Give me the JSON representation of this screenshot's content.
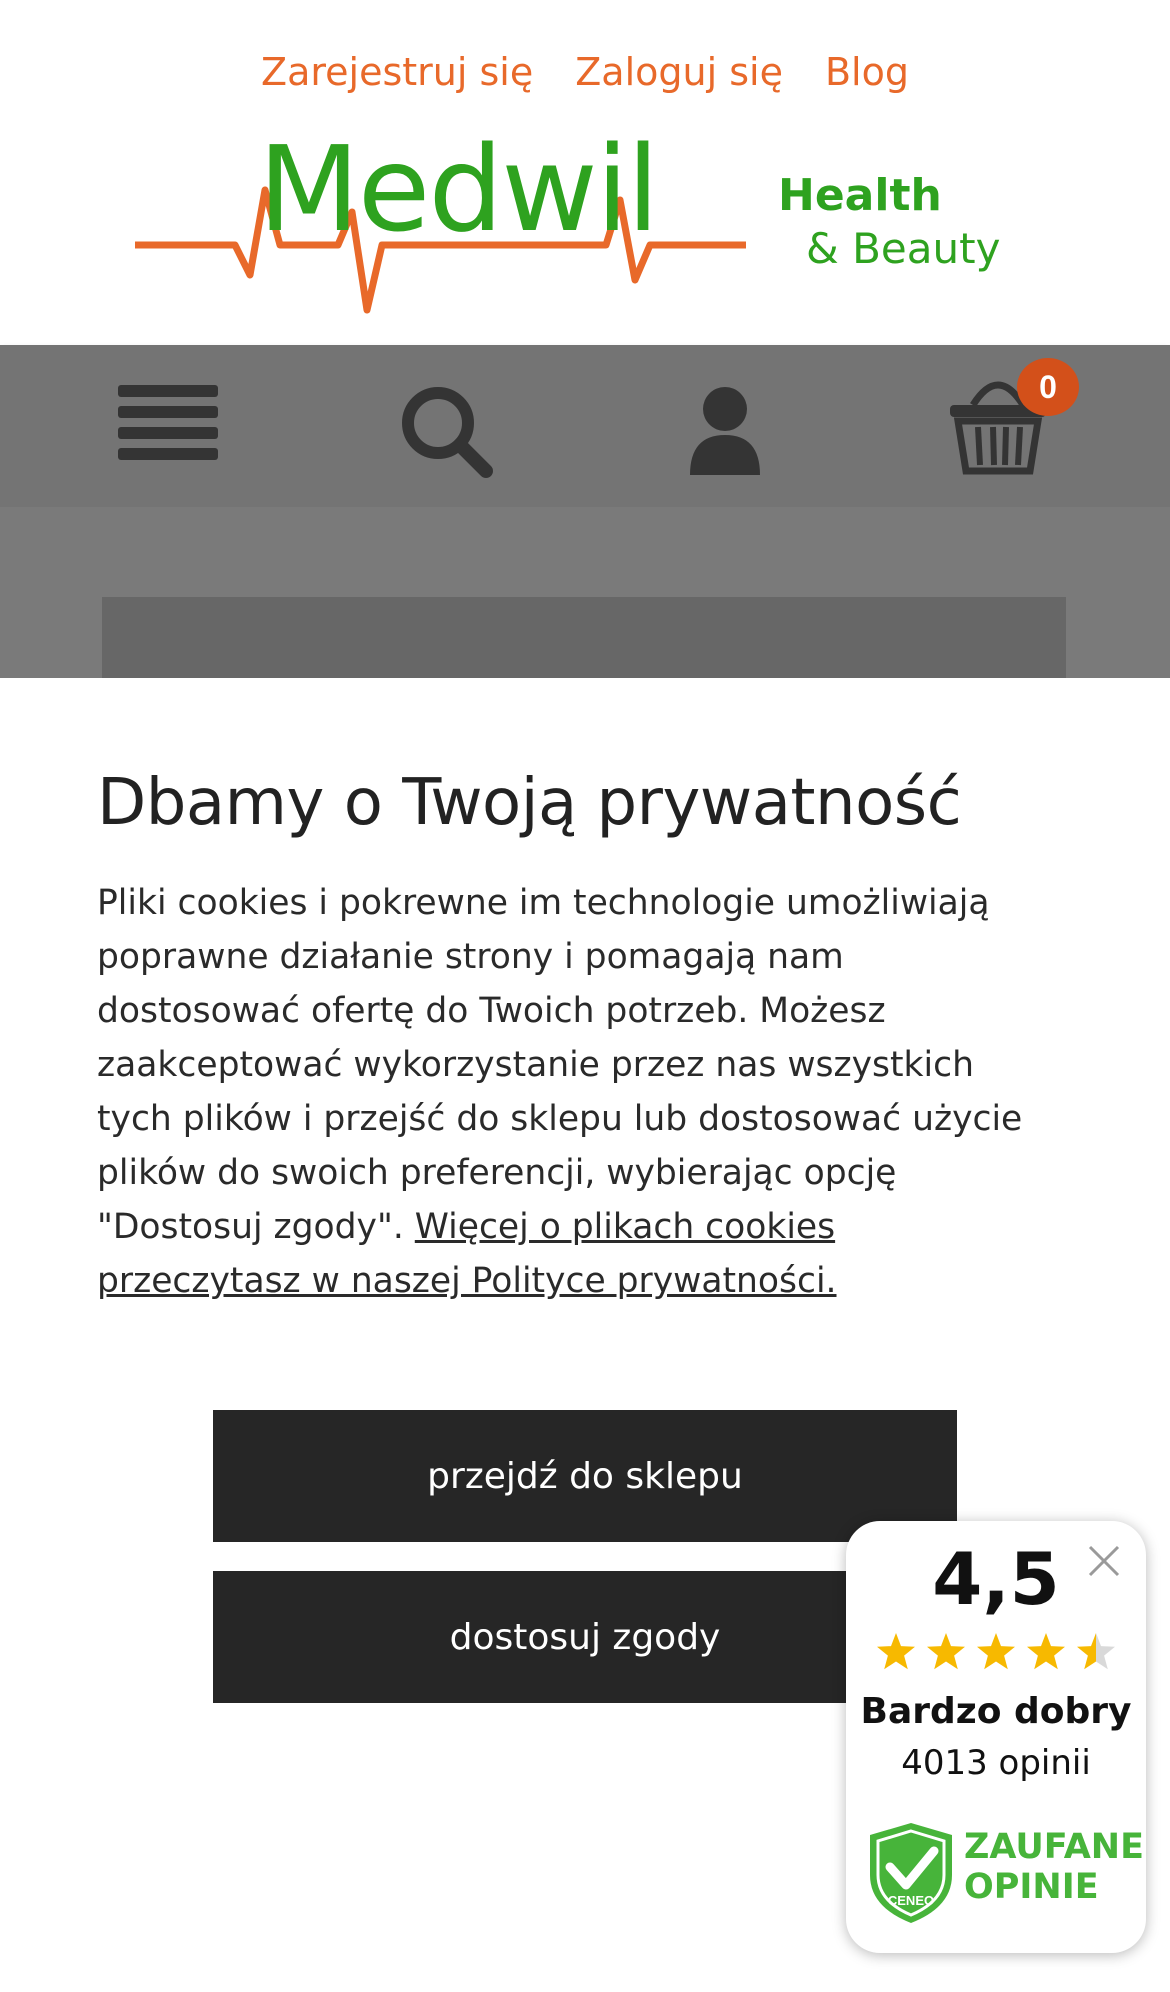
{
  "header": {
    "links": [
      "Zarejestruj się",
      "Zaloguj się",
      "Blog"
    ],
    "logo_text": "Medwil",
    "tagline_1": "Health",
    "tagline_2": "& Beauty"
  },
  "navbar": {
    "cart_count": "0",
    "icons": [
      "menu-icon",
      "search-icon",
      "user-icon",
      "cart-icon"
    ]
  },
  "cookie_dialog": {
    "title": "Dbamy o Twoją prywatność",
    "body": "Pliki cookies i pokrewne im technologie umożliwiają poprawne działanie strony i pomagają nam dostosować ofertę do Twoich potrzeb. Możesz zaakceptować wykorzystanie przez nas wszystkich tych plików i przejść do sklepu lub dostosować użycie plików do swoich preferencji, wybierając opcję \"Dostosuj zgody\".",
    "link_text": "Więcej o plikach cookies przeczytasz w naszej Polityce prywatności.",
    "accept_label": "przejdź do sklepu",
    "customize_label": "dostosuj zgody"
  },
  "ceneo_widget": {
    "score": "4,5",
    "rating": 4.5,
    "verdict": "Bardzo dobry",
    "reviews": "4013 opinii",
    "badge_line1": "ZAUFANE",
    "badge_line2": "OPINIE",
    "shield_label": "CENEO"
  },
  "colors": {
    "accent_orange": "#e8692a",
    "brand_green": "#2ea21f",
    "button_dark": "#262626",
    "star_yellow": "#f7b900",
    "badge_green": "#47b43a"
  }
}
